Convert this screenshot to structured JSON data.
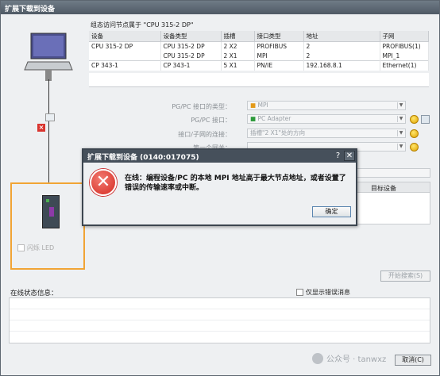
{
  "window": {
    "title": "扩展下载到设备"
  },
  "nodes": {
    "caption": "组态访问节点属于 \"CPU 315-2 DP\"",
    "columns": [
      "设备",
      "设备类型",
      "插槽",
      "接口类型",
      "地址",
      "子网"
    ],
    "rows": [
      [
        "CPU 315-2 DP",
        "CPU 315-2 DP",
        "2 X2",
        "PROFIBUS",
        "2",
        "PROFIBUS(1)"
      ],
      [
        "",
        "CPU 315-2 DP",
        "2 X1",
        "MPI",
        "2",
        "MPI_1"
      ],
      [
        "CP 343-1",
        "CP 343-1",
        "5 X1",
        "PN/IE",
        "192.168.8.1",
        "Ethernet(1)"
      ]
    ]
  },
  "form": {
    "iface_type_label": "PG/PC 接口的类型：",
    "iface_type_value": "MPI",
    "iface_label": "PG/PC 接口：",
    "iface_value": "PC Adapter",
    "subnet_conn_label": "接口/子网的连接：",
    "subnet_conn_value": "插槽\"2 X1\"处的方向",
    "gateway_label": "第一个网关：",
    "gateway_value": ""
  },
  "left": {
    "blink_led_label": "闪烁 LED"
  },
  "target": {
    "header": "目标设备"
  },
  "buttons": {
    "start_search": "开始搜索(S)",
    "cancel": "取消(C)"
  },
  "status": {
    "label": "在线状态信息：",
    "errors_only_label": "仅显示错误消息"
  },
  "dialog": {
    "title": "扩展下载到设备 (0140:017075)",
    "help": "?",
    "close": "✕",
    "message": "在线：编程设备/PC 的本地 MPI 地址高于最大节点地址，或者设置了错误的传输速率或中断。",
    "ok_label": "确定"
  },
  "watermark": {
    "text": "公众号 · tanwxz"
  },
  "colors": {
    "accent_orange": "#f1a435",
    "error_red": "#d52b22",
    "titlebar": "#4f5a65"
  }
}
